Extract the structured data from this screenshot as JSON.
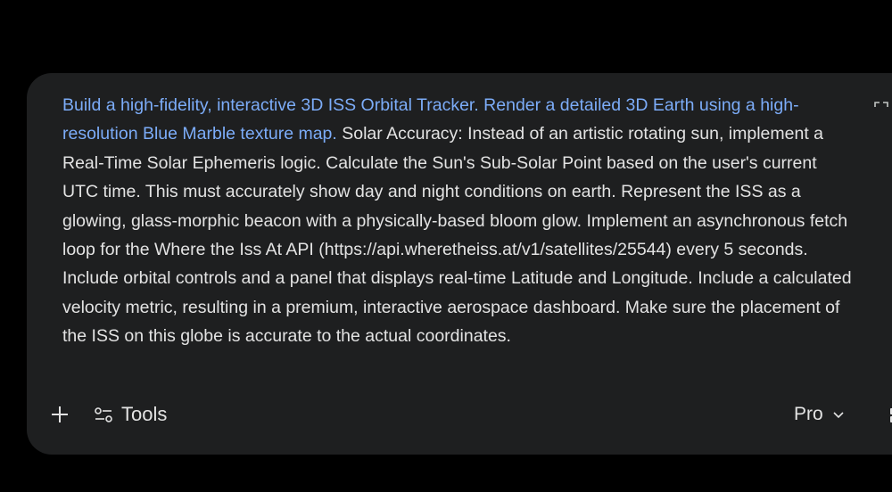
{
  "composer": {
    "prompt_highlight": "Build a high-fidelity, interactive 3D ISS Orbital Tracker. Render a detailed 3D Earth using a high-resolution Blue Marble texture map.",
    "prompt_rest": " Solar Accuracy: Instead of an artistic rotating sun, implement a Real-Time Solar Ephemeris logic. Calculate the Sun's Sub-Solar Point based on the user's current UTC time. This must accurately show day and night conditions on earth. Represent the ISS as a glowing, glass-morphic beacon with a physically-based bloom glow. Implement an asynchronous fetch loop for the Where the Iss At API (https://api.wheretheiss.at/v1/satellites/25544) every 5 seconds. Include orbital controls and a panel that displays real-time Latitude and Longitude. Include a calculated velocity metric, resulting in a premium, interactive aerospace dashboard. Make sure the placement of the ISS on this globe is accurate to the actual coordinates.",
    "expand_icon": "expand-icon"
  },
  "toolbar": {
    "add_icon": "plus-icon",
    "tools_icon": "tools-sliders-icon",
    "tools_label": "Tools",
    "model_label": "Pro",
    "model_chevron_icon": "chevron-down-icon",
    "apps_icon": "apps-grid-icon"
  },
  "colors": {
    "background": "#000000",
    "composer_bg": "#1e1f20",
    "text": "#e3e3e3",
    "highlight": "#7cacf8"
  }
}
